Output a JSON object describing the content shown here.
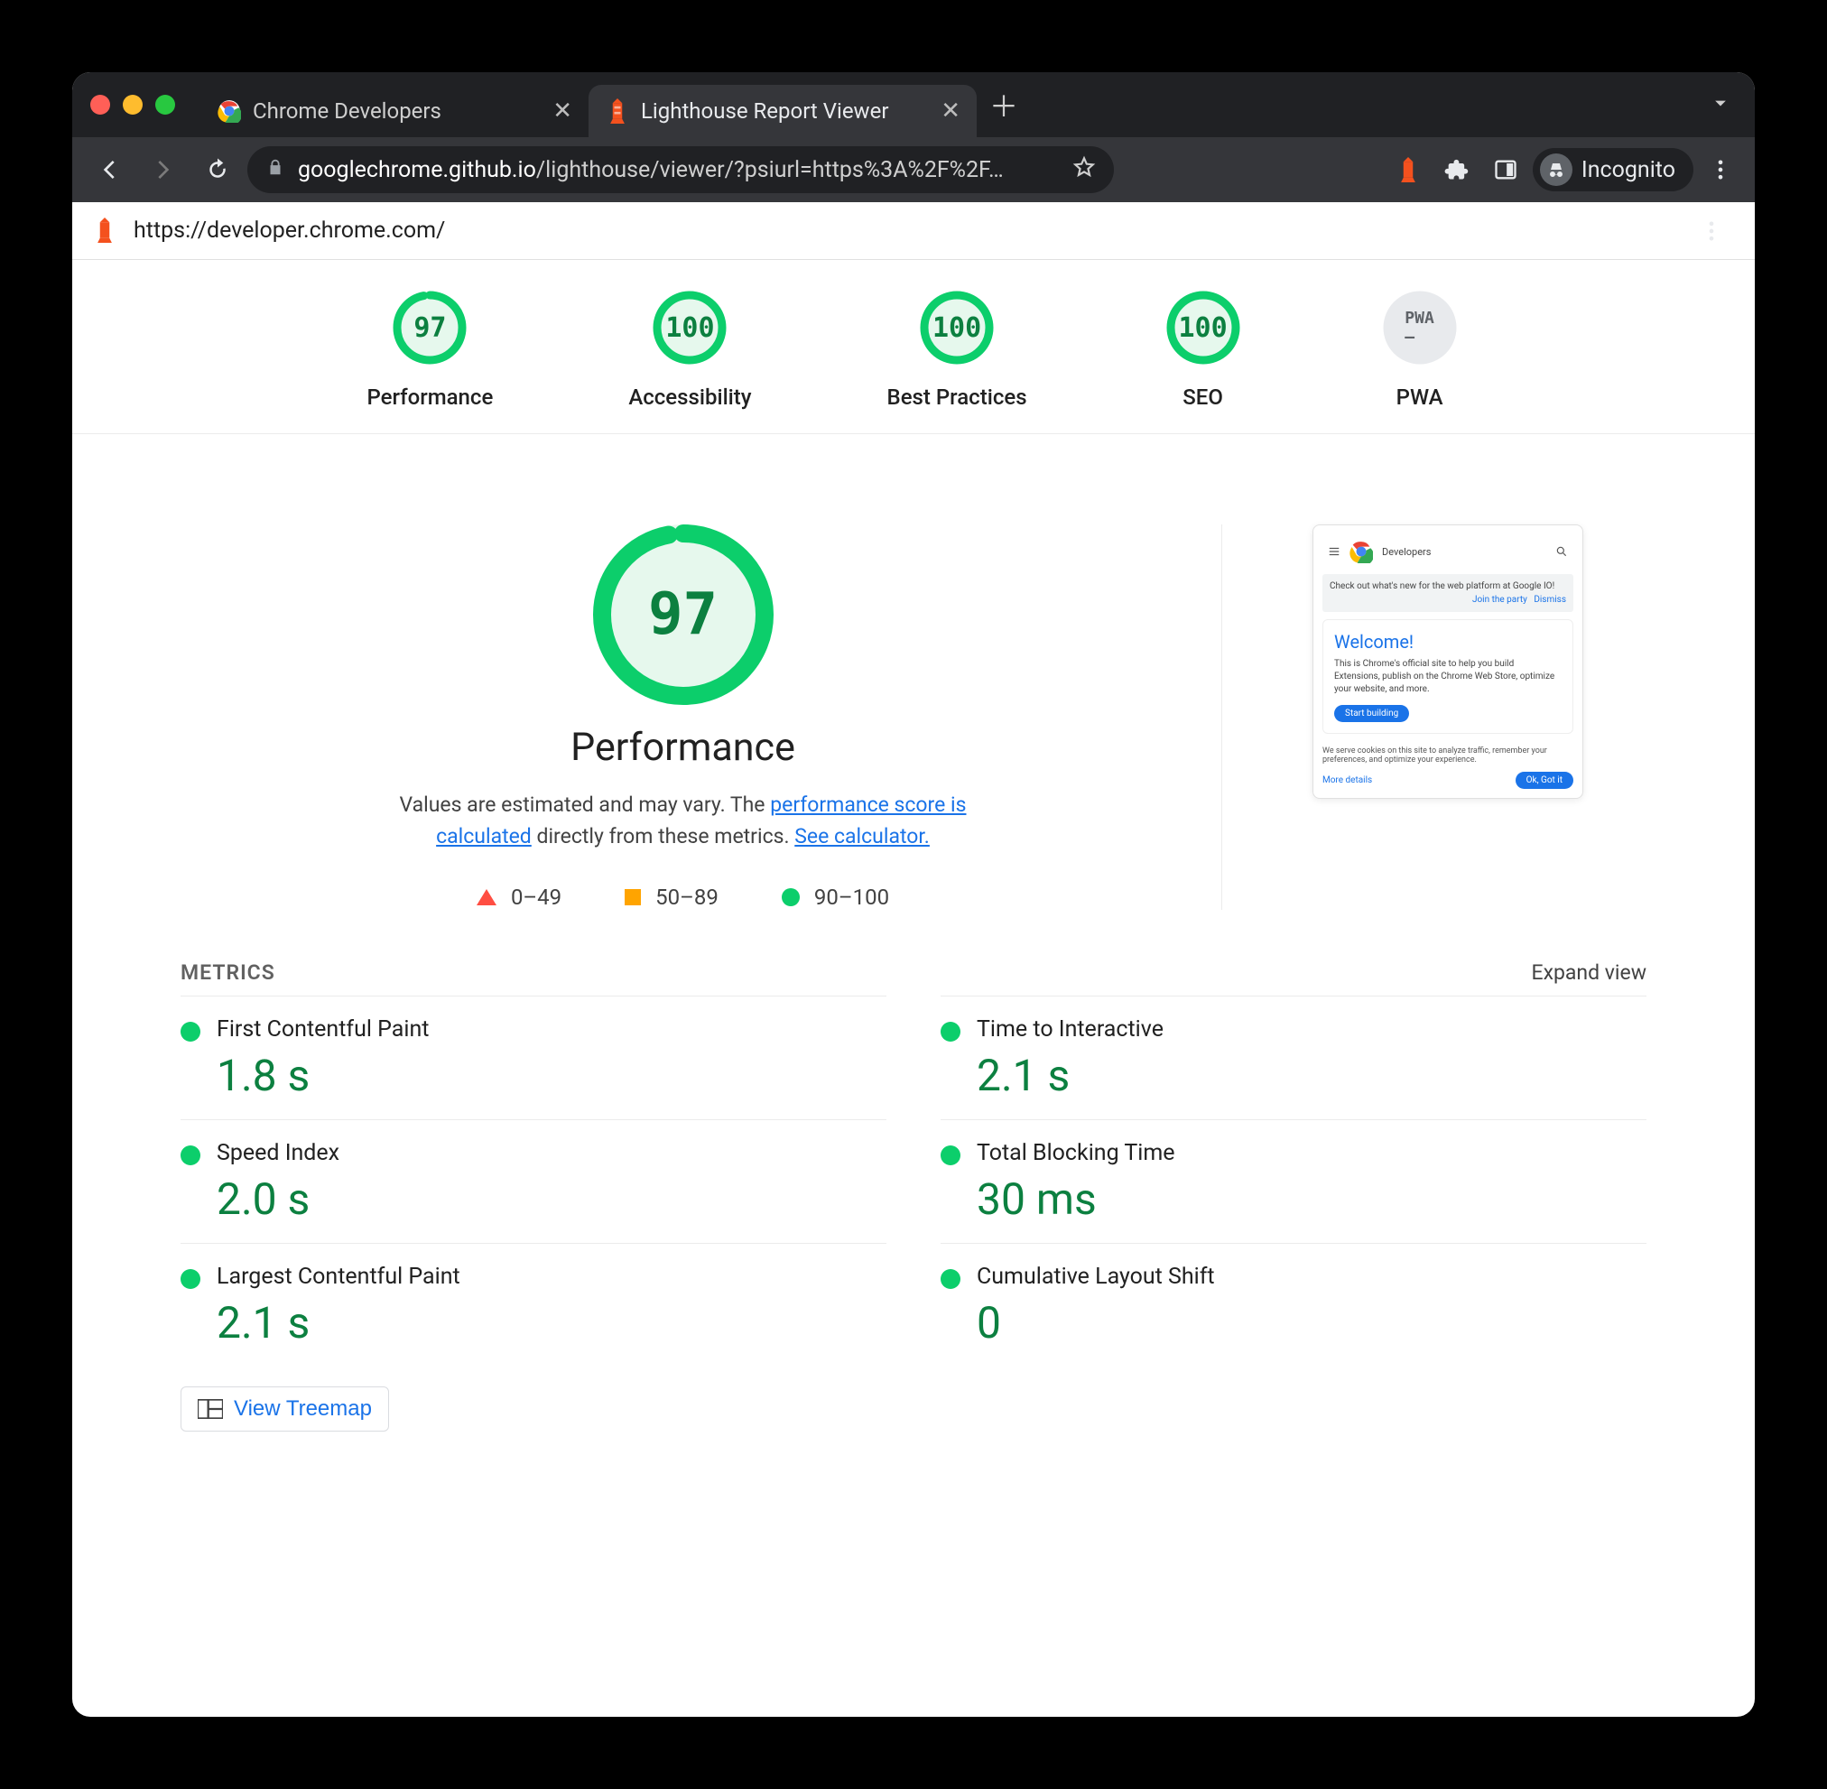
{
  "browser": {
    "tabs": [
      {
        "title": "Chrome Developers",
        "active": false
      },
      {
        "title": "Lighthouse Report Viewer",
        "active": true
      }
    ],
    "omnibox": {
      "host": "googlechrome.github.io",
      "path": "/lighthouse/viewer/?psiurl=https%3A%2F%2F…"
    },
    "incognito_label": "Incognito"
  },
  "viewer": {
    "tested_url": "https://developer.chrome.com/"
  },
  "summary": {
    "gauges": [
      {
        "id": "performance",
        "label": "Performance",
        "score": 97,
        "pct": 97
      },
      {
        "id": "accessibility",
        "label": "Accessibility",
        "score": 100,
        "pct": 100
      },
      {
        "id": "best-practices",
        "label": "Best Practices",
        "score": 100,
        "pct": 100
      },
      {
        "id": "seo",
        "label": "SEO",
        "score": 100,
        "pct": 100
      },
      {
        "id": "pwa",
        "label": "PWA",
        "score": "PWA",
        "pct": 0,
        "grey": true
      }
    ]
  },
  "performance": {
    "title": "Performance",
    "score": 97,
    "pct": 97,
    "blurb_pre": "Values are estimated and may vary. The ",
    "link1": "performance score is calculated",
    "blurb_mid": " directly from these metrics. ",
    "link2": "See calculator.",
    "legend": {
      "r0": "0–49",
      "r1": "50–89",
      "r2": "90–100"
    }
  },
  "metrics": {
    "heading": "METRICS",
    "expand": "Expand view",
    "items": [
      {
        "name": "First Contentful Paint",
        "value": "1.8 s"
      },
      {
        "name": "Time to Interactive",
        "value": "2.1 s"
      },
      {
        "name": "Speed Index",
        "value": "2.0 s"
      },
      {
        "name": "Total Blocking Time",
        "value": "30 ms"
      },
      {
        "name": "Largest Contentful Paint",
        "value": "2.1 s"
      },
      {
        "name": "Cumulative Layout Shift",
        "value": "0"
      }
    ],
    "treemap": "View Treemap"
  },
  "thumbnail": {
    "brand": "Developers",
    "banner_text": "Check out what's new for the web platform at Google IO!",
    "banner_cta1": "Join the party",
    "banner_cta2": "Dismiss",
    "welcome_title": "Welcome!",
    "welcome_body": "This is Chrome's official site to help you build Extensions, publish on the Chrome Web Store, optimize your website, and more.",
    "welcome_btn": "Start building",
    "cookie_text": "We serve cookies on this site to analyze traffic, remember your preferences, and optimize your experience.",
    "cookie_more": "More details",
    "cookie_ok": "Ok, Got it"
  }
}
